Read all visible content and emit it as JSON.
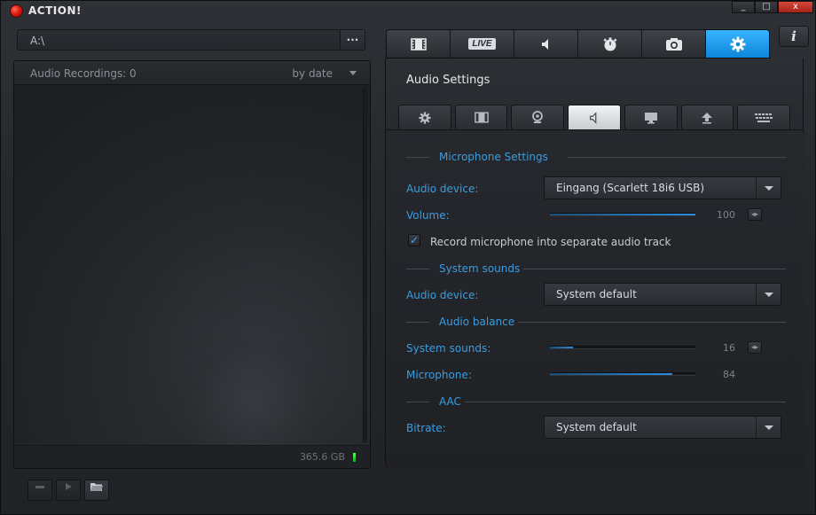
{
  "app": {
    "title": "ACTION!",
    "window_controls": [
      "_",
      "□",
      "x"
    ]
  },
  "path": {
    "value": "A:\\",
    "browse_label": "..."
  },
  "recordings": {
    "count_label": "Audio Recordings: 0",
    "sort_label": "by date",
    "disk_free": "365.6 GB",
    "disk_status_color": "#3fdc3f"
  },
  "main_tabs": [
    {
      "icon": "film-icon"
    },
    {
      "icon": "live-icon",
      "label": "LIVE"
    },
    {
      "icon": "speaker-icon"
    },
    {
      "icon": "stopwatch-icon"
    },
    {
      "icon": "camera-icon"
    },
    {
      "icon": "gear-icon",
      "active": true
    }
  ],
  "info_label": "i",
  "settings": {
    "title": "Audio Settings",
    "sub_tabs": [
      {
        "icon": "gear-icon"
      },
      {
        "icon": "film-icon"
      },
      {
        "icon": "webcam-icon"
      },
      {
        "icon": "speaker-icon",
        "active": true
      },
      {
        "icon": "monitor-icon"
      },
      {
        "icon": "upload-icon"
      },
      {
        "icon": "keyboard-icon"
      }
    ],
    "microphone_section": "Microphone Settings",
    "mic_device_label": "Audio device:",
    "mic_device_value": "Eingang (Scarlett 18i6 USB)",
    "volume_label": "Volume:",
    "volume_value": "100",
    "volume_fraction": 1.0,
    "separate_track_label": "Record microphone into separate audio track",
    "separate_track_checked": true,
    "system_section": "System sounds",
    "sys_device_label": "Audio device:",
    "sys_device_value": "System default",
    "balance_section": "Audio balance",
    "balance_system_label": "System sounds:",
    "balance_system_value": "16",
    "balance_system_fraction": 0.16,
    "balance_mic_label": "Microphone:",
    "balance_mic_value": "84",
    "balance_mic_fraction": 0.84,
    "aac_section": "AAC",
    "bitrate_label": "Bitrate:",
    "bitrate_value": "System default"
  },
  "bottom_buttons": [
    "delete-icon",
    "play-icon",
    "folder-icon"
  ],
  "accent_color": "#1e90e8"
}
